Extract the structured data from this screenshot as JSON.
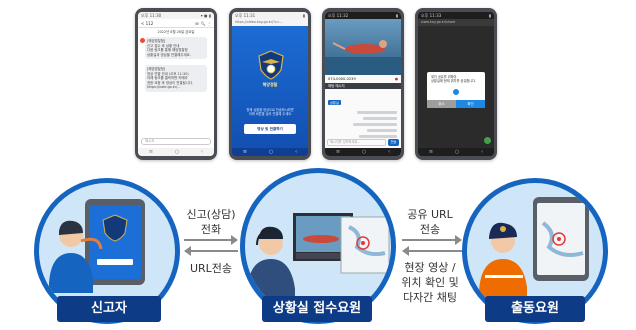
{
  "phone_sms": {
    "status_time": "오후 11:30",
    "status_icons": "▾ ● ▮",
    "contact": "< 112",
    "header_icons": "☏ 🔍 ⋮",
    "date_line": "2022년 8월 26일 금요일",
    "bubble1": "[해양경찰청]\n신고 접수 후 상황 안내\n다음 링크를 통해 해양경찰청\n상황실과 영상을 연결해주세요.",
    "bubble2": "[해양경찰청]\n영상 연결 안내 (오후 11:30)\n아래 링크를 클릭하면 카메라\n권한 요청 후 영상이 연결됩니다.\nhttps://nokr.go.kr/...",
    "input_placeholder": "메시지"
  },
  "phone_app": {
    "status_time": "오후 11:31",
    "url": "https://video.kcg.go.kr/?v=...",
    "emblem_text": "해양경찰",
    "message": "현재 상황을 영상으로 전송하시려면\n아래 버튼을 눌러 연결해 주세요",
    "connect_button": "영상 및 연결하기"
  },
  "phone_video": {
    "status_time": "오후 11:32",
    "call_number": "074-0000-0239",
    "chat_title": "채팅 메시지",
    "chat_tag": "상황실",
    "input_placeholder": "메시지를 입력하세요...",
    "send_label": "전송"
  },
  "phone_dialog": {
    "status_time": "오후 11:33",
    "url": "www.kcg.go.kr/share",
    "dialog_text": "위치 공유를 위하여\n상황실에 현재 위치를 공유합니다.",
    "cancel": "취소",
    "confirm": "확인"
  },
  "circles": {
    "left_label": "신고자",
    "mid_label": "상황실 접수요원",
    "right_label": "출동요원"
  },
  "flows": {
    "call_line1": "신고(상담)",
    "call_line2": "전화",
    "url_send": "URL전송",
    "share_line1": "공유 URL",
    "share_line2": "전송",
    "field_line1": "현장 영상 /",
    "field_line2": "위치 확인 및",
    "field_line3": "다자간 채팅"
  },
  "colors": {
    "circle_border": "#1565c0",
    "circle_fill": "#cfe6f8",
    "label_bg": "#0d3b86",
    "app_blue": "#1d6fd8",
    "arrow": "#8a8a8a"
  }
}
